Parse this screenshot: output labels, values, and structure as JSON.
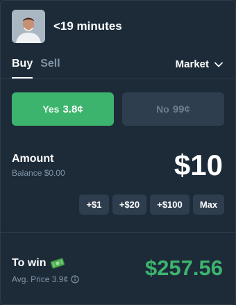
{
  "market": {
    "title": "<19 minutes"
  },
  "tabs": {
    "buy": "Buy",
    "sell": "Sell",
    "active": "buy"
  },
  "order_type": {
    "value": "Market",
    "icon": "chevron-down-icon"
  },
  "outcomes": {
    "yes": {
      "label": "Yes",
      "price": "3.8¢",
      "color": "#3db46d"
    },
    "no": {
      "label": "No",
      "price": "99¢",
      "color": "#2f3e4e"
    }
  },
  "amount": {
    "label": "Amount",
    "balance": "Balance $0.00",
    "value": "$10"
  },
  "quick_add": [
    "+$1",
    "+$20",
    "+$100",
    "Max"
  ],
  "to_win": {
    "label": "To win",
    "icon": "money-icon",
    "avg_price": "Avg. Price 3.9¢",
    "info_icon": "info-icon",
    "value": "$257.56",
    "color": "#3db46d"
  }
}
